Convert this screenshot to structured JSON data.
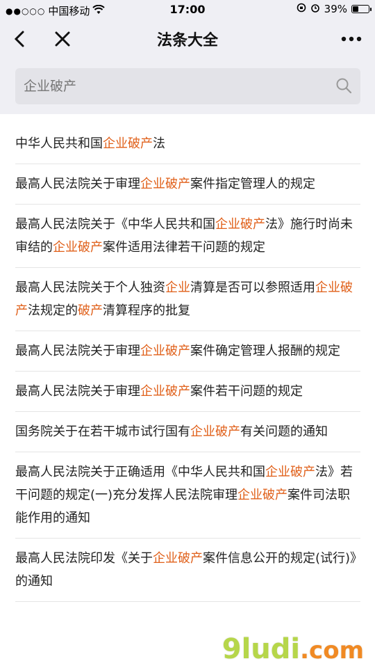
{
  "status_bar": {
    "signal_dots": "●●○○○",
    "carrier": "中国移动",
    "time": "17:00",
    "battery_percent": "39%",
    "battery_level": 0.39
  },
  "nav": {
    "title": "法条大全"
  },
  "search": {
    "placeholder": "企业破产"
  },
  "results": [
    {
      "segments": [
        {
          "t": "中华人民共和国",
          "h": false
        },
        {
          "t": "企业破产",
          "h": true
        },
        {
          "t": "法",
          "h": false
        }
      ]
    },
    {
      "segments": [
        {
          "t": "最高人民法院关于审理",
          "h": false
        },
        {
          "t": "企业破产",
          "h": true
        },
        {
          "t": "案件指定管理人的规定",
          "h": false
        }
      ]
    },
    {
      "segments": [
        {
          "t": "最高人民法院关于《中华人民共和国",
          "h": false
        },
        {
          "t": "企业破产",
          "h": true
        },
        {
          "t": "法》施行时尚未审结的",
          "h": false
        },
        {
          "t": "企业破产",
          "h": true
        },
        {
          "t": "案件适用法律若干问题的规定",
          "h": false
        }
      ]
    },
    {
      "segments": [
        {
          "t": "最高人民法院关于个人独资",
          "h": false
        },
        {
          "t": "企业",
          "h": true
        },
        {
          "t": "清算是否可以参照适用",
          "h": false
        },
        {
          "t": "企业破产",
          "h": true
        },
        {
          "t": "法规定的",
          "h": false
        },
        {
          "t": "破产",
          "h": true
        },
        {
          "t": "清算程序的批复",
          "h": false
        }
      ]
    },
    {
      "segments": [
        {
          "t": "最高人民法院关于审理",
          "h": false
        },
        {
          "t": "企业破产",
          "h": true
        },
        {
          "t": "案件确定管理人报酬的规定",
          "h": false
        }
      ]
    },
    {
      "segments": [
        {
          "t": "最高人民法院关于审理",
          "h": false
        },
        {
          "t": "企业破产",
          "h": true
        },
        {
          "t": "案件若干问题的规定",
          "h": false
        }
      ]
    },
    {
      "segments": [
        {
          "t": "国务院关于在若干城市试行国有",
          "h": false
        },
        {
          "t": "企业破产",
          "h": true
        },
        {
          "t": "有关问题的通知",
          "h": false
        }
      ]
    },
    {
      "segments": [
        {
          "t": "最高人民法院关于正确适用《中华人民共和国",
          "h": false
        },
        {
          "t": "企业破产",
          "h": true
        },
        {
          "t": "法》若干问题的规定(一)充分发挥人民法院审理",
          "h": false
        },
        {
          "t": "企业破产",
          "h": true
        },
        {
          "t": "案件司法职能作用的通知",
          "h": false
        }
      ]
    },
    {
      "segments": [
        {
          "t": "最高人民法院印发《关于",
          "h": false
        },
        {
          "t": "企业破产",
          "h": true
        },
        {
          "t": "案件信息公开的规定(试行)》的通知",
          "h": false
        }
      ]
    }
  ],
  "watermark": {
    "brand": "9ludi",
    "tld": ".com"
  }
}
